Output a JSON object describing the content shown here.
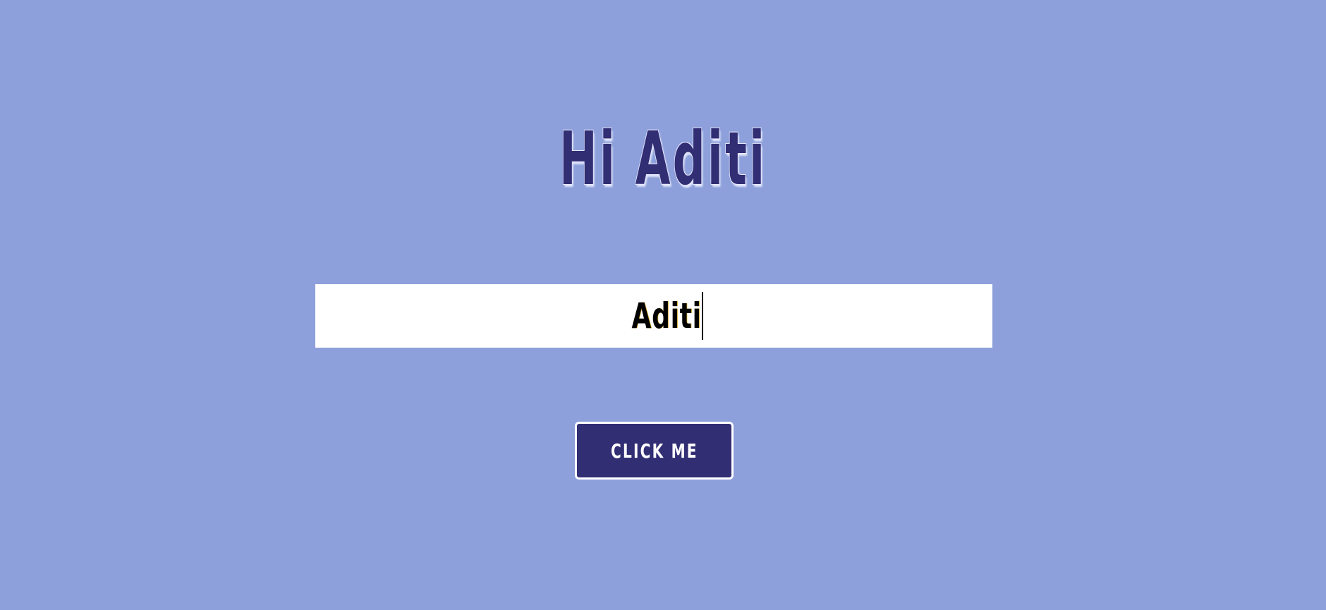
{
  "greeting": {
    "prefix": "Hi",
    "name": "Aditi"
  },
  "name_input": {
    "value": "Aditi"
  },
  "button": {
    "label": "CLICK ME"
  },
  "colors": {
    "background": "#8da0db",
    "accent": "#312e74",
    "input_background": "#ffffff"
  }
}
